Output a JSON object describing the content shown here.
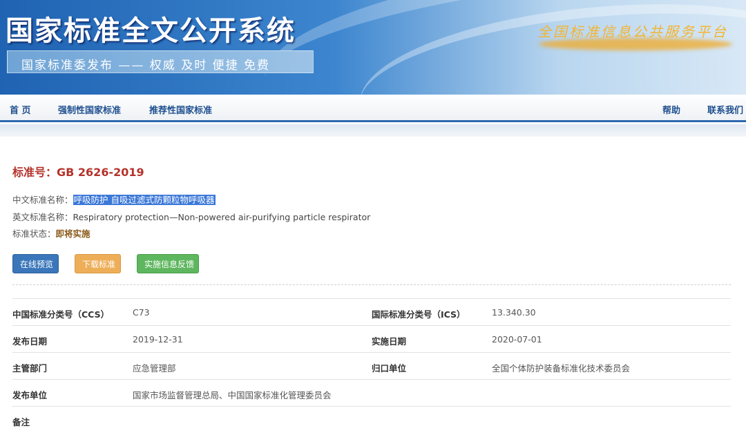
{
  "header": {
    "site_title": "国家标准全文公开系统",
    "slogan": "国家标准委发布 —— 权威 及时 便捷 免费",
    "platform": "全国标准信息公共服务平台"
  },
  "nav": {
    "home": "首 页",
    "mandatory": "强制性国家标准",
    "recommended": "推荐性国家标准",
    "help": "帮助",
    "contact": "联系我们"
  },
  "standard": {
    "number_label": "标准号：",
    "number": "GB 2626-2019",
    "cn_name_label": "中文标准名称：",
    "cn_name": "呼吸防护 自吸过滤式防颗粒物呼吸器",
    "en_name_label": "英文标准名称：",
    "en_name": "Respiratory protection—Non-powered air-purifying particle respirator",
    "status_label": "标准状态：",
    "status": "即将实施"
  },
  "buttons": {
    "preview": "在线预览",
    "download": "下载标准",
    "feedback": "实施信息反馈"
  },
  "details": {
    "ccs_label": "中国标准分类号（CCS）",
    "ccs": "C73",
    "ics_label": "国际标准分类号（ICS）",
    "ics": "13.340.30",
    "publish_date_label": "发布日期",
    "publish_date": "2019-12-31",
    "effective_date_label": "实施日期",
    "effective_date": "2020-07-01",
    "department_label": "主管部门",
    "department": "应急管理部",
    "owner_label": "归口单位",
    "owner": "全国个体防护装备标准化技术委员会",
    "publisher_label": "发布单位",
    "publisher": "国家市场监督管理总局、中国国家标准化管理委员会",
    "remarks_label": "备注",
    "remarks": ""
  },
  "colors": {
    "title_red": "#b5322b",
    "nav_blue": "#1e4f8f",
    "btn_blue": "#3a76b9",
    "btn_orange": "#eeae58",
    "btn_green": "#5eb65e"
  }
}
